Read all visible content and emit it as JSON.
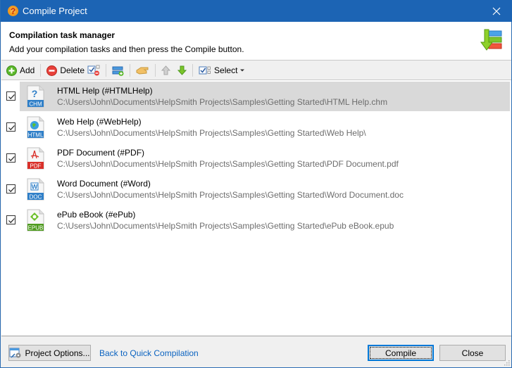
{
  "window": {
    "title": "Compile Project",
    "close_icon": "close-icon",
    "app_icon": "helpsmith-app-icon"
  },
  "header": {
    "title": "Compilation task manager",
    "subtitle": "Add your compilation tasks and then press the Compile button.",
    "icon": "compile-tasks-icon"
  },
  "toolbar": {
    "add_label": "Add",
    "delete_label": "Delete",
    "select_label": "Select",
    "icons": [
      "add-icon",
      "delete-icon",
      "delete-unchecked-icon",
      "add-task-icon",
      "hand-icon",
      "move-up-icon",
      "move-down-icon",
      "select-icon"
    ]
  },
  "tasks": [
    {
      "name": "HTML Help (#HTMLHelp)",
      "path": "C:\\Users\\John\\Documents\\HelpSmith Projects\\Samples\\Getting Started\\HTML Help.chm",
      "badge": "CHM",
      "checked": true,
      "selected": true,
      "icon": "chm-file-icon",
      "badge_color": "#2f7fc8"
    },
    {
      "name": "Web Help (#WebHelp)",
      "path": "C:\\Users\\John\\Documents\\HelpSmith Projects\\Samples\\Getting Started\\Web Help\\",
      "badge": "HTML",
      "checked": true,
      "selected": false,
      "icon": "html-file-icon",
      "badge_color": "#2f7fc8"
    },
    {
      "name": "PDF Document (#PDF)",
      "path": "C:\\Users\\John\\Documents\\HelpSmith Projects\\Samples\\Getting Started\\PDF Document.pdf",
      "badge": "PDF",
      "checked": true,
      "selected": false,
      "icon": "pdf-file-icon",
      "badge_color": "#d9302a"
    },
    {
      "name": "Word Document (#Word)",
      "path": "C:\\Users\\John\\Documents\\HelpSmith Projects\\Samples\\Getting Started\\Word Document.doc",
      "badge": "DOC",
      "checked": true,
      "selected": false,
      "icon": "doc-file-icon",
      "badge_color": "#2f7fc8"
    },
    {
      "name": "ePub eBook (#ePub)",
      "path": "C:\\Users\\John\\Documents\\HelpSmith Projects\\Samples\\Getting Started\\ePub eBook.epub",
      "badge": "EPUB",
      "checked": true,
      "selected": false,
      "icon": "epub-file-icon",
      "badge_color": "#4e9a1e"
    }
  ],
  "footer": {
    "project_options_label": "Project Options...",
    "back_link_label": "Back to Quick Compilation",
    "compile_label": "Compile",
    "close_label": "Close"
  },
  "colors": {
    "titlebar": "#1c64b4",
    "selection": "#d9d9d9",
    "link": "#0b63c0",
    "path_text": "#6d6d6d"
  }
}
